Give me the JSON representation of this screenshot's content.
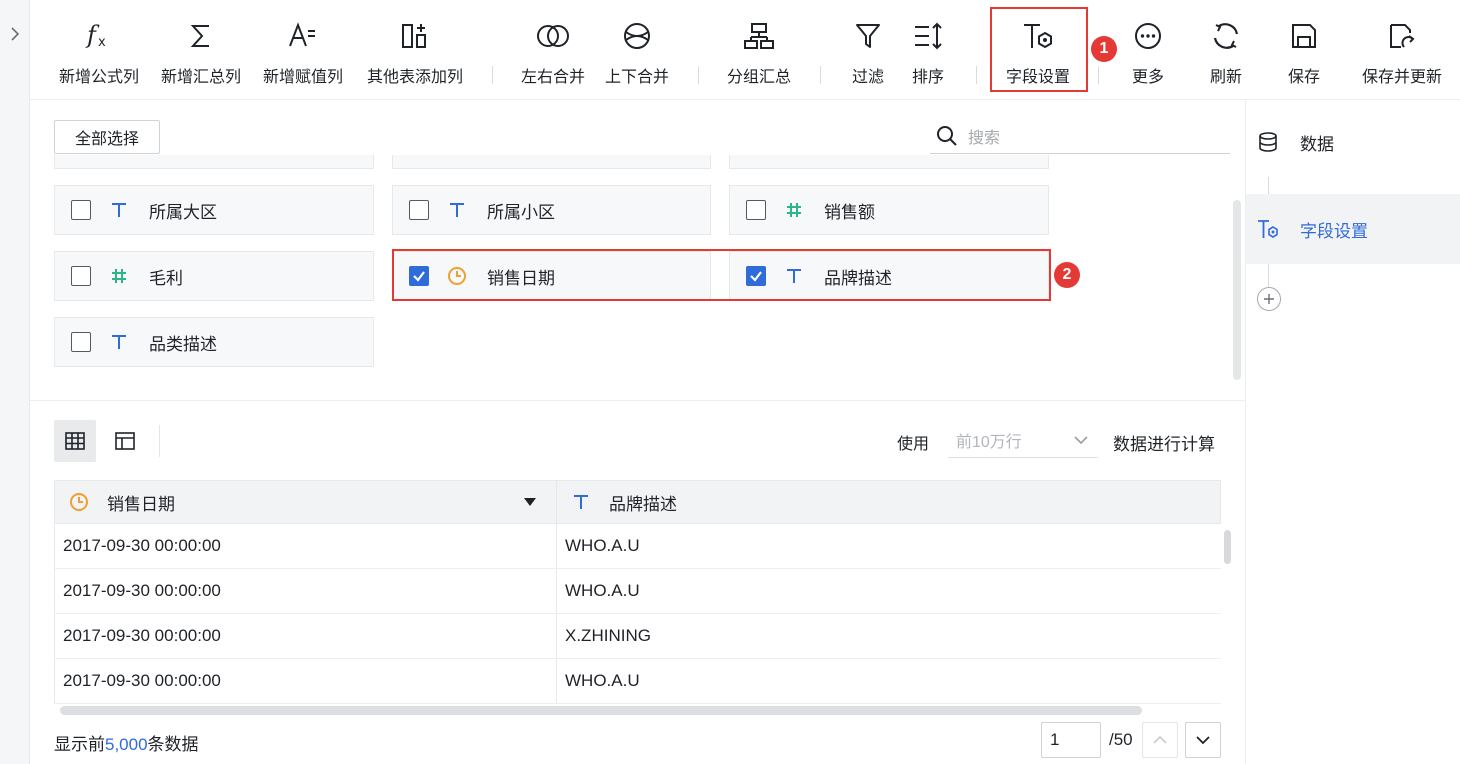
{
  "toolbar": {
    "items": [
      {
        "label": "新增公式列",
        "icon": "formula-icon"
      },
      {
        "label": "新增汇总列",
        "icon": "sigma-icon"
      },
      {
        "label": "新增赋值列",
        "icon": "assign-icon"
      },
      {
        "label": "其他表添加列",
        "icon": "add-column-icon"
      },
      {
        "label": "左右合并",
        "icon": "merge-horizontal-icon"
      },
      {
        "label": "上下合并",
        "icon": "merge-vertical-icon"
      },
      {
        "label": "分组汇总",
        "icon": "group-summary-icon"
      },
      {
        "label": "过滤",
        "icon": "filter-icon"
      },
      {
        "label": "排序",
        "icon": "sort-icon"
      },
      {
        "label": "字段设置",
        "icon": "field-settings-icon"
      },
      {
        "label": "更多",
        "icon": "more-icon"
      },
      {
        "label": "刷新",
        "icon": "refresh-icon"
      },
      {
        "label": "保存",
        "icon": "save-icon"
      },
      {
        "label": "保存并更新",
        "icon": "save-update-icon"
      }
    ]
  },
  "annotations": {
    "badge1": "1",
    "badge2": "2"
  },
  "fields_panel": {
    "select_all_label": "全部选择",
    "search_placeholder": "搜索",
    "fields": [
      {
        "name": "所属大区",
        "type": "text",
        "checked": false
      },
      {
        "name": "所属小区",
        "type": "text",
        "checked": false
      },
      {
        "name": "销售额",
        "type": "number",
        "checked": false
      },
      {
        "name": "毛利",
        "type": "number",
        "checked": false
      },
      {
        "name": "销售日期",
        "type": "date",
        "checked": true
      },
      {
        "name": "品牌描述",
        "type": "text",
        "checked": true
      },
      {
        "name": "品类描述",
        "type": "text",
        "checked": false
      }
    ]
  },
  "preview": {
    "use_label": "使用",
    "row_limit_value": "前10万行",
    "calc_label": "数据进行计算",
    "columns": [
      {
        "name": "销售日期",
        "type": "date"
      },
      {
        "name": "品牌描述",
        "type": "text"
      }
    ],
    "rows": [
      [
        "2017-09-30 00:00:00",
        "WHO.A.U"
      ],
      [
        "2017-09-30 00:00:00",
        "WHO.A.U"
      ],
      [
        "2017-09-30 00:00:00",
        "X.ZHINING"
      ],
      [
        "2017-09-30 00:00:00",
        "WHO.A.U"
      ]
    ],
    "footer_prefix": "显示前",
    "footer_count": "5,000",
    "footer_suffix": "条数据",
    "page_value": "1",
    "page_total": "/50"
  },
  "right_panel": {
    "items": [
      {
        "label": "数据",
        "icon": "database-icon"
      },
      {
        "label": "字段设置",
        "icon": "field-settings-icon"
      }
    ]
  },
  "colors": {
    "accent": "#2f6bd9",
    "highlight": "#e53935",
    "date_icon": "#f0a030",
    "text_icon": "#2f6bd9",
    "number_icon": "#2bb58a"
  }
}
